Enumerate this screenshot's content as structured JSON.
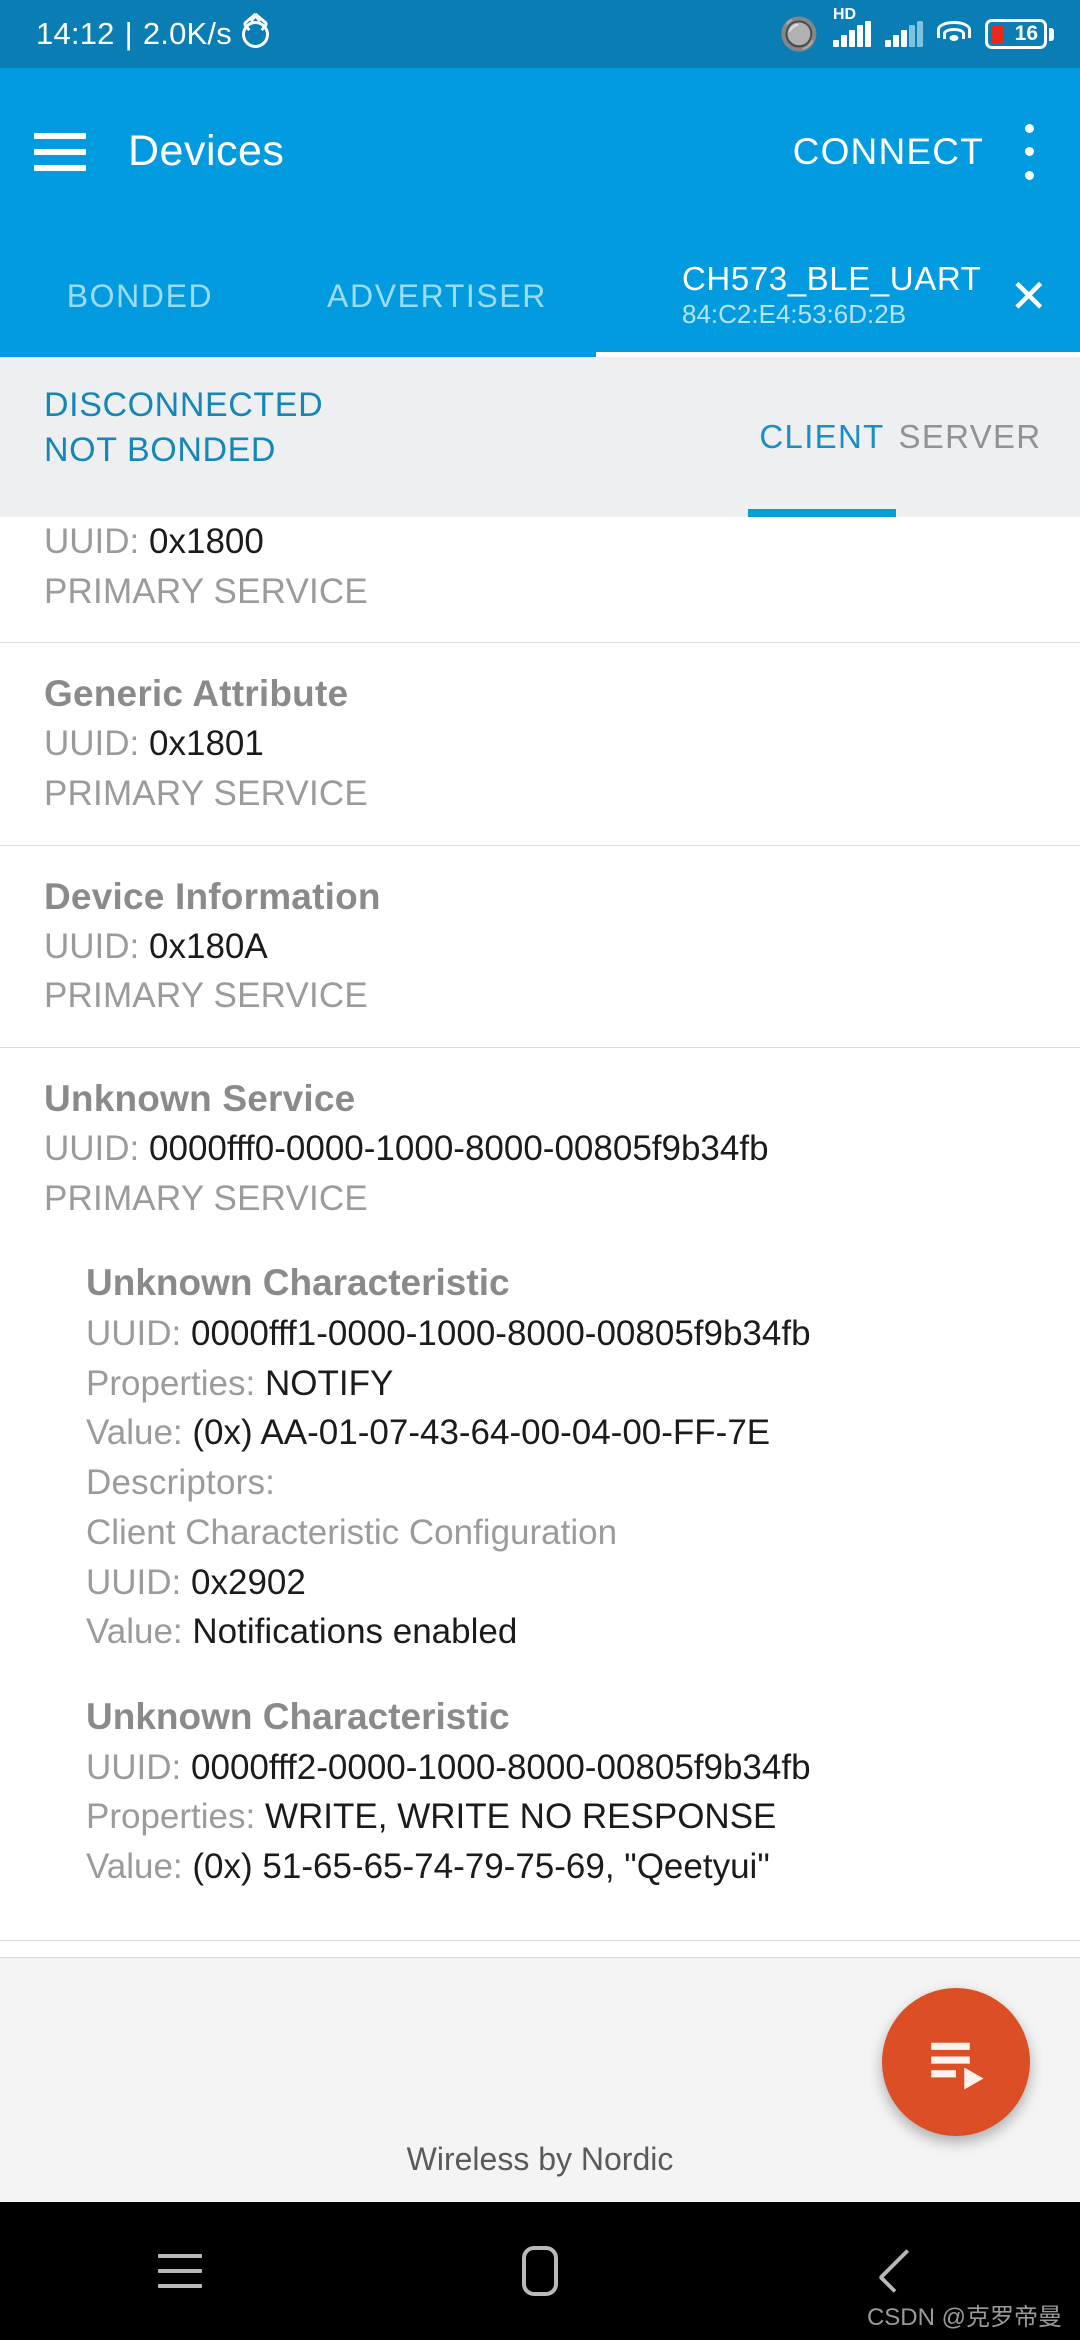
{
  "status_bar": {
    "time": "14:12",
    "separator": "|",
    "network_speed": "2.0K/s",
    "alarm_icon": "alarm-icon",
    "bluetooth_icon": "bluetooth-icon",
    "hd_label": "HD",
    "signal_icon_1": "signal-bars-icon",
    "signal_icon_2": "signal-bars-dim-icon",
    "wifi_icon": "wifi-icon",
    "battery_level": "16"
  },
  "app_bar": {
    "menu_icon": "hamburger-menu-icon",
    "title": "Devices",
    "connect_label": "CONNECT",
    "overflow_icon": "overflow-menu-icon"
  },
  "device_tabs": {
    "bonded_label": "BONDED",
    "advertiser_label": "ADVERTISER",
    "active_device_name": "CH573_BLE_UART",
    "active_device_mac": "84:C2:E4:53:6D:2B",
    "close_icon": "close-icon",
    "close_glyph": "✕"
  },
  "connection": {
    "state": "DISCONNECTED",
    "bond_state": "NOT BONDED",
    "client_tab": "CLIENT",
    "server_tab": "SERVER"
  },
  "labels": {
    "uuid": "UUID:",
    "properties": "Properties:",
    "value": "Value:",
    "descriptors": "Descriptors:"
  },
  "services": [
    {
      "name": "",
      "clipped": true,
      "uuid": "0x1800",
      "type": "PRIMARY SERVICE",
      "characteristics": []
    },
    {
      "name": "Generic Attribute",
      "clipped": false,
      "uuid": "0x1801",
      "type": "PRIMARY SERVICE",
      "characteristics": []
    },
    {
      "name": "Device Information",
      "clipped": false,
      "uuid": "0x180A",
      "type": "PRIMARY SERVICE",
      "characteristics": []
    },
    {
      "name": "Unknown Service",
      "clipped": false,
      "uuid": "0000fff0-0000-1000-8000-00805f9b34fb",
      "type": "PRIMARY SERVICE",
      "characteristics": [
        {
          "name": "Unknown Characteristic",
          "uuid": "0000fff1-0000-1000-8000-00805f9b34fb",
          "properties": "NOTIFY",
          "value": "(0x) AA-01-07-43-64-00-04-00-FF-7E",
          "has_descriptors": true,
          "descriptor_name": "Client Characteristic Configuration",
          "descriptor_uuid": "0x2902",
          "descriptor_value": "Notifications enabled"
        },
        {
          "name": "Unknown Characteristic",
          "uuid": "0000fff2-0000-1000-8000-00805f9b34fb",
          "properties": "WRITE, WRITE NO RESPONSE",
          "value": "(0x) 51-65-65-74-79-75-69, \"Qeetyui\"",
          "has_descriptors": false,
          "descriptor_name": "",
          "descriptor_uuid": "",
          "descriptor_value": ""
        }
      ]
    }
  ],
  "footer": {
    "text": "Wireless by Nordic",
    "fab_icon": "playlist-play-icon"
  },
  "nav_bar": {
    "recents_icon": "recents-icon",
    "home_icon": "home-icon",
    "back_icon": "back-icon",
    "watermark": "CSDN @克罗帝曼"
  },
  "colors": {
    "status_bar": "#0a7db5",
    "app_bar": "#039be0",
    "accent": "#00a0d2",
    "fab": "#dc4e26",
    "state_text": "#1586b8"
  }
}
